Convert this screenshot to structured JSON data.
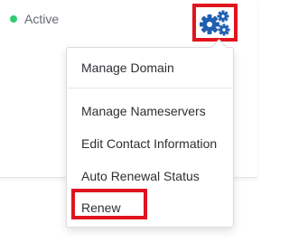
{
  "status": {
    "label": "Active",
    "color": "#2ecc71"
  },
  "settings_button": {
    "icon": "gears-icon",
    "highlight_color": "#e0141e",
    "icon_color": "#1f5fb0"
  },
  "menu": {
    "items": [
      {
        "label": "Manage Domain"
      },
      {
        "label": "Manage Nameservers"
      },
      {
        "label": "Edit Contact Information"
      },
      {
        "label": "Auto Renewal Status"
      },
      {
        "label": "Renew"
      }
    ]
  }
}
